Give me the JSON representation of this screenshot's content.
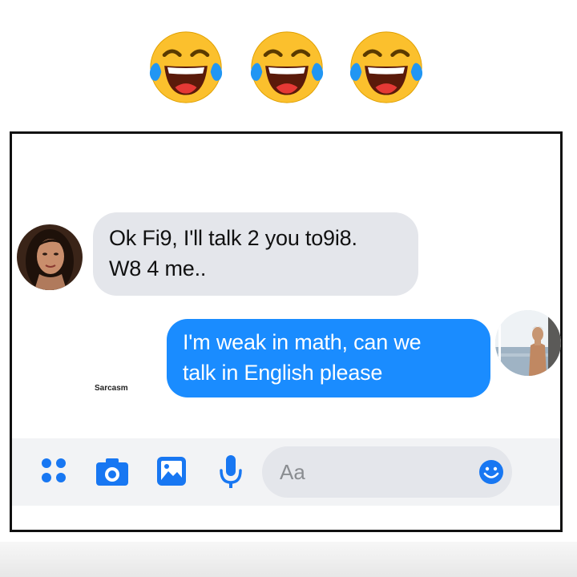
{
  "header": {
    "emojis": [
      "face-with-tears-of-joy",
      "face-with-tears-of-joy",
      "face-with-tears-of-joy"
    ]
  },
  "chat": {
    "incoming": {
      "lines": [
        "Ok Fi9, I'll talk 2 you to9i8.",
        "W8 4 me.."
      ],
      "bubble_color": "#e4e6eb"
    },
    "outgoing": {
      "lines": [
        "I'm weak in math, can we",
        "talk in English please"
      ],
      "bubble_color": "#1a8cff"
    },
    "watermark": "Sarcasm"
  },
  "composer": {
    "icons": [
      "apps-grid-icon",
      "camera-icon",
      "gallery-icon",
      "microphone-icon",
      "emoji-icon"
    ],
    "placeholder": "Aa",
    "accent": "#1877f2"
  }
}
